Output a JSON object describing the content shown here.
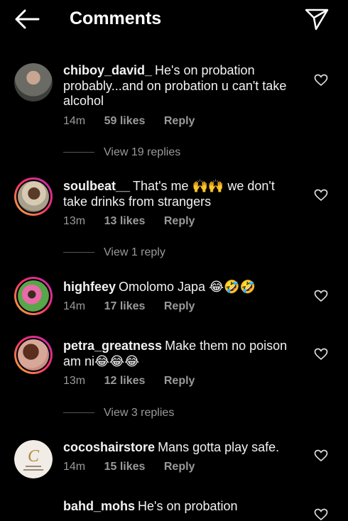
{
  "header": {
    "title": "Comments"
  },
  "comments": [
    {
      "username": "chiboy_david_",
      "text": "He's on probation probably...and on probation u can't take alcohol",
      "time": "14m",
      "likes": "59 likes",
      "reply": "Reply",
      "view_replies": "View 19 replies"
    },
    {
      "username": "soulbeat__",
      "text": "That's me 🙌🙌 we don't take drinks from strangers",
      "time": "13m",
      "likes": "13 likes",
      "reply": "Reply",
      "view_replies": "View 1 reply"
    },
    {
      "username": "highfeey",
      "text": "Omolomo Japa 😂🤣🤣",
      "time": "14m",
      "likes": "17 likes",
      "reply": "Reply"
    },
    {
      "username": "petra_greatness",
      "text": "Make them no poison am ni😂😂😂",
      "time": "13m",
      "likes": "12 likes",
      "reply": "Reply",
      "view_replies": "View 3 replies"
    },
    {
      "username": "cocoshairstore",
      "text": "Mans gotta play safe.",
      "time": "14m",
      "likes": "15 likes",
      "reply": "Reply"
    },
    {
      "username": "bahd_mohs",
      "text": "He's on probation"
    }
  ],
  "colors": {
    "background": "#000000",
    "secondary_text": "#9a9a9a",
    "story_ring": [
      "#f7b733",
      "#f5316a",
      "#c32ab5"
    ]
  }
}
